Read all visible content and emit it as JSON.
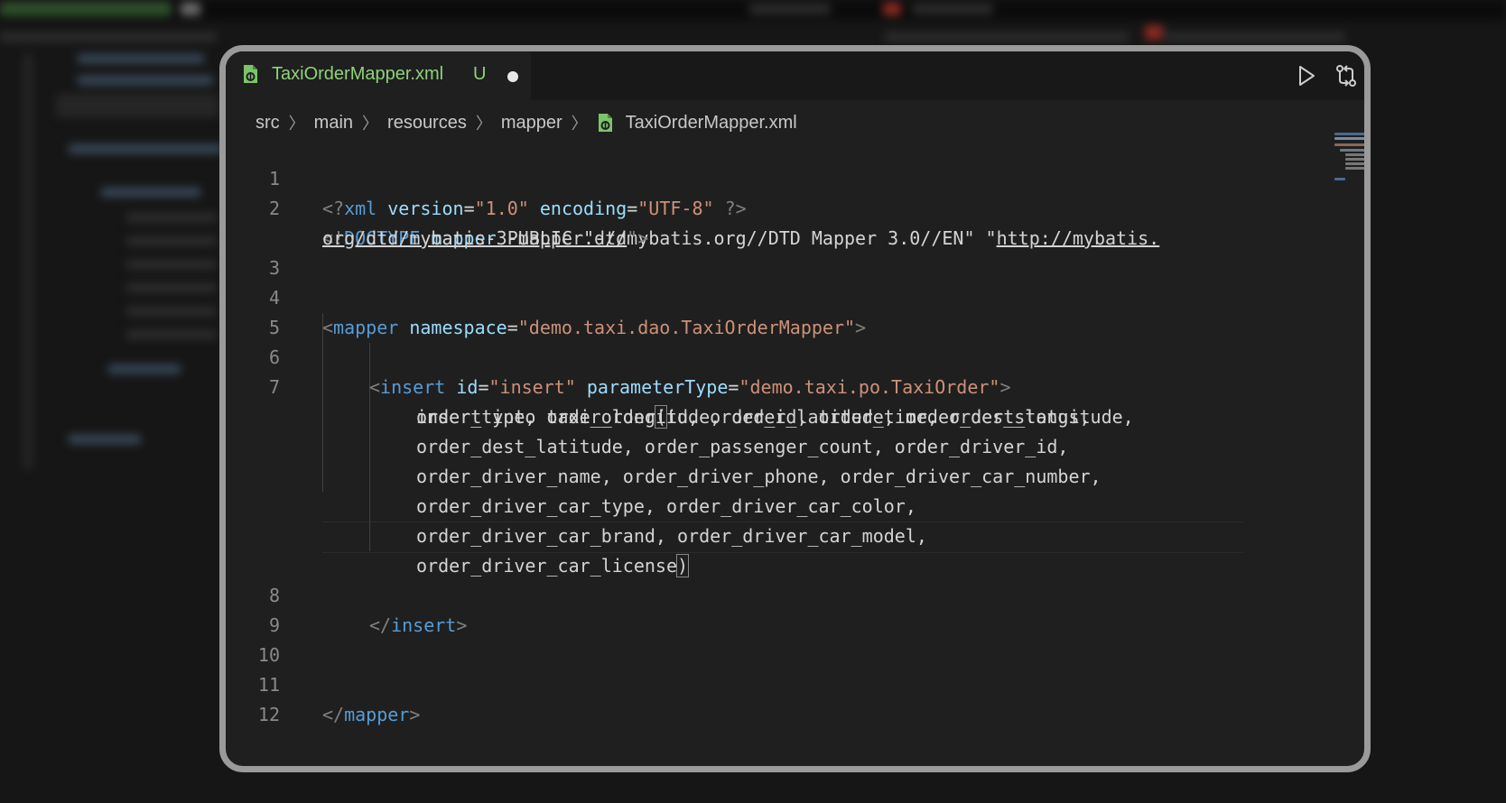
{
  "tab": {
    "filename": "TaxiOrderMapper.xml",
    "status": "U"
  },
  "breadcrumb": [
    "src",
    "main",
    "resources",
    "mapper",
    "TaxiOrderMapper.xml"
  ],
  "icons": {
    "file": "xml-file-icon",
    "run": "run-icon",
    "compare": "compare-changes-icon",
    "unsaved": "unsaved-dot-icon"
  },
  "colors": {
    "tab_text": "#8fd27a",
    "tag": "#569cd6",
    "attribute": "#9cdcfe",
    "string": "#ce9178",
    "text": "#d4d4d4"
  },
  "code": {
    "line_numbers": [
      "1",
      "2",
      "3",
      "4",
      "5",
      "6",
      "7",
      "8",
      "9",
      "10",
      "11",
      "12"
    ],
    "l1": {
      "open": "<?",
      "name": "xml",
      "a1": "version",
      "eq1": "=",
      "v1": "\"1.0\"",
      "a2": "encoding",
      "eq2": "=",
      "v2": "\"UTF-8\"",
      "close": "?>"
    },
    "l2": {
      "open": "<!",
      "name": "DOCTYPE",
      "root": "mapper",
      "rest": "PUBLIC \"-//mybatis.org//DTD Mapper 3.0//EN\" \"",
      "url1": "http://mybatis.",
      "url2": "org/dtd/mybatis-3-mapper.dtd",
      "end": "\">"
    },
    "l4": {
      "open": "<",
      "name": "mapper",
      "a1": "namespace",
      "eq": "=",
      "v1": "\"demo.taxi.dao.TaxiOrderMapper\"",
      "close": ">"
    },
    "l6": {
      "open": "<",
      "name": "insert",
      "a1": "id",
      "eq1": "=",
      "v1": "\"insert\"",
      "a2": "parameterType",
      "eq2": "=",
      "v2": "\"demo.taxi.po.TaxiOrder\"",
      "close": ">"
    },
    "sql": {
      "pre": "insert into taxi_order",
      "paren_open": "(",
      "w0": "id, order_id, order_time, order_status,",
      "w1": "order_type, order_longitude, order_latitude, order_dest_longitude,",
      "w2": "order_dest_latitude, order_passenger_count, order_driver_id,",
      "w3": "order_driver_name, order_driver_phone, order_driver_car_number,",
      "w4": "order_driver_car_type, order_driver_car_color,",
      "w5": "order_driver_car_brand, order_driver_car_model,",
      "w6": "order_driver_car_license",
      "paren_close": ")"
    },
    "l8": {
      "open": "</",
      "name": "insert",
      "close": ">"
    },
    "l11": {
      "open": "</",
      "name": "mapper",
      "close": ">"
    }
  }
}
